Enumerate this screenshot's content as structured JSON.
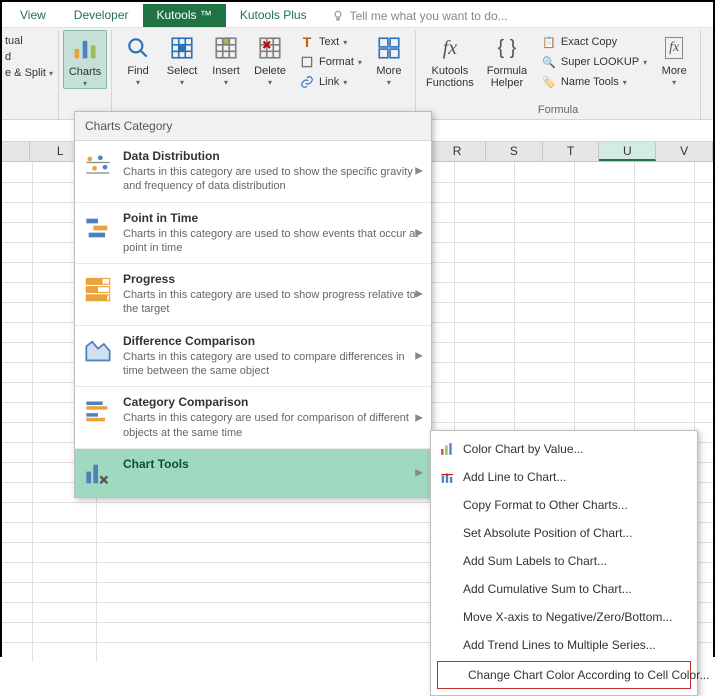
{
  "tabs": {
    "view": "View",
    "developer": "Developer",
    "kutools": "Kutools ™",
    "kutools_plus": "Kutools Plus",
    "tell_me": "Tell me what you want to do..."
  },
  "ribbon_partial_left": {
    "item1": "tual",
    "item2": "d",
    "item3": "e & Split"
  },
  "ribbon": {
    "charts": "Charts",
    "find": "Find",
    "select": "Select",
    "insert": "Insert",
    "delete": "Delete",
    "text": "Text",
    "format": "Format",
    "link": "Link",
    "more1": "More",
    "kutools_functions": "Kutools\nFunctions",
    "formula_helper": "Formula\nHelper",
    "exact_copy": "Exact Copy",
    "super_lookup": "Super LOOKUP",
    "name_tools": "Name Tools",
    "more2": "More",
    "group_formula": "Formula"
  },
  "columns": [
    "",
    "L",
    "",
    "",
    "",
    "",
    "",
    "",
    "R",
    "S",
    "T",
    "U",
    "V"
  ],
  "dropdown": {
    "header": "Charts Category",
    "items": [
      {
        "title": "Data Distribution",
        "desc": "Charts in this category are used to show the specific gravity and frequency of data distribution"
      },
      {
        "title": "Point in Time",
        "desc": "Charts in this category are used to show events that occur at point in time"
      },
      {
        "title": "Progress",
        "desc": "Charts in this category are used to show progress relative to the target"
      },
      {
        "title": "Difference Comparison",
        "desc": "Charts in this category are used to compare differences in time between the same object"
      },
      {
        "title": "Category Comparison",
        "desc": "Charts in this category are used for comparison of different objects at the same time"
      },
      {
        "title": "Chart Tools",
        "desc": ""
      }
    ]
  },
  "submenu": {
    "items": [
      "Color Chart by Value...",
      "Add Line to Chart...",
      "Copy Format to Other Charts...",
      "Set Absolute Position of Chart...",
      "Add Sum Labels to Chart...",
      "Add Cumulative Sum to Chart...",
      "Move X-axis to Negative/Zero/Bottom...",
      "Add Trend Lines to Multiple Series...",
      "Change Chart Color According to Cell Color..."
    ]
  }
}
